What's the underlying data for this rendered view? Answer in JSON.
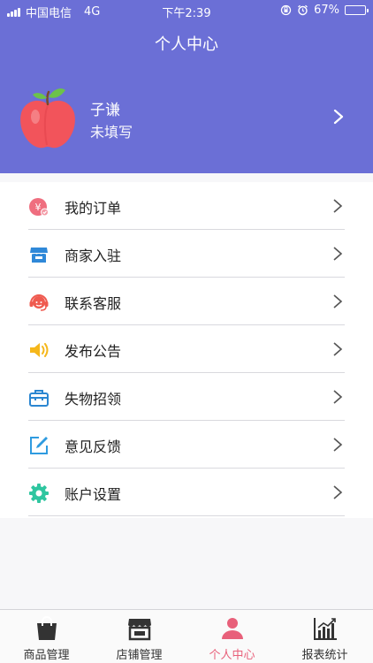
{
  "status_bar": {
    "carrier": "中国电信",
    "network": "4G",
    "time": "下午2:39",
    "battery_percent": "67%",
    "battery_level": 0.67
  },
  "header": {
    "title": "个人中心",
    "bg_color": "#6b6fd6"
  },
  "profile": {
    "name": "子谦",
    "subtitle": "未填写",
    "avatar_icon": "apple-icon"
  },
  "menu": {
    "items": [
      {
        "label": "我的订单",
        "icon": "order-icon",
        "icon_color": "#ef6e7f"
      },
      {
        "label": "商家入驻",
        "icon": "shop-icon",
        "icon_color": "#2f88d8"
      },
      {
        "label": "联系客服",
        "icon": "customer-service-icon",
        "icon_color": "#ef5a4f"
      },
      {
        "label": "发布公告",
        "icon": "speaker-icon",
        "icon_color": "#f5b71b"
      },
      {
        "label": "失物招领",
        "icon": "bag-icon",
        "icon_color": "#2a86d1"
      },
      {
        "label": "意见反馈",
        "icon": "edit-icon",
        "icon_color": "#2f9be0"
      },
      {
        "label": "账户设置",
        "icon": "gear-icon",
        "icon_color": "#2fc6a0"
      }
    ]
  },
  "tabbar": {
    "active_color": "#e8607a",
    "tabs": [
      {
        "label": "商品管理",
        "icon": "bag-icon",
        "active": false
      },
      {
        "label": "店铺管理",
        "icon": "store-icon",
        "active": false
      },
      {
        "label": "个人中心",
        "icon": "user-icon",
        "active": true
      },
      {
        "label": "报表统计",
        "icon": "chart-icon",
        "active": false
      }
    ]
  }
}
